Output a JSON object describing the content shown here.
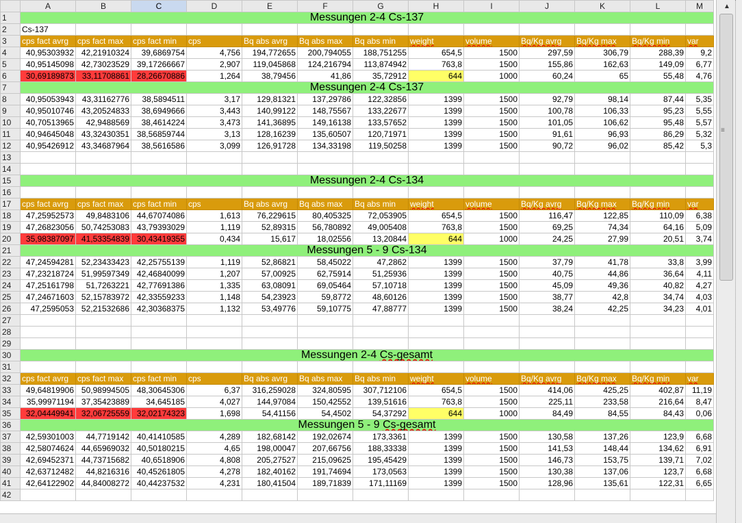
{
  "columns": [
    "A",
    "B",
    "C",
    "D",
    "E",
    "F",
    "G",
    "H",
    "I",
    "J",
    "K",
    "L",
    "M"
  ],
  "selected_column": "C",
  "rows": [
    {
      "n": "1",
      "type": "band",
      "text": "Messungen 2-4 Cs-137"
    },
    {
      "n": "2",
      "type": "text",
      "cells": [
        "Cs-137",
        "",
        "",
        "",
        "",
        "",
        "",
        "",
        "",
        "",
        "",
        "",
        ""
      ]
    },
    {
      "n": "3",
      "type": "hdr",
      "cells": [
        "cps fact avrg",
        "cps fact max",
        "cps fact min",
        "cps",
        "Bq abs avrg",
        "Bq abs max",
        "Bq abs min",
        "weight",
        "volume",
        "Bq/Kg avrg",
        "Bq/Kg max",
        "Bq/Kg min",
        "var"
      ]
    },
    {
      "n": "4",
      "type": "data",
      "cells": [
        "40,95303932",
        "42,21910324",
        "39,6869754",
        "4,756",
        "194,772655",
        "200,794055",
        "188,751255",
        "654,5",
        "1500",
        "297,59",
        "306,79",
        "288,39",
        "9,2"
      ]
    },
    {
      "n": "5",
      "type": "data",
      "cells": [
        "40,95145098",
        "42,73023529",
        "39,17266667",
        "2,907",
        "119,045868",
        "124,216794",
        "113,874942",
        "763,8",
        "1500",
        "155,86",
        "162,63",
        "149,09",
        "6,77"
      ]
    },
    {
      "n": "6",
      "type": "data",
      "red": true,
      "cells": [
        "30,69189873",
        "33,11708861",
        "28,26670886",
        "1,264",
        "38,79456",
        "41,86",
        "35,72912",
        "644",
        "1000",
        "60,24",
        "65",
        "55,48",
        "4,76"
      ]
    },
    {
      "n": "7",
      "type": "band",
      "text": "Messungen 2-4 Cs-137"
    },
    {
      "n": "8",
      "type": "data",
      "cells": [
        "40,95053943",
        "43,31162776",
        "38,5894511",
        "3,17",
        "129,81321",
        "137,29786",
        "122,32856",
        "1399",
        "1500",
        "92,79",
        "98,14",
        "87,44",
        "5,35"
      ]
    },
    {
      "n": "9",
      "type": "data",
      "cells": [
        "40,95010746",
        "43,20524833",
        "38,6949666",
        "3,443",
        "140,99122",
        "148,75567",
        "133,22677",
        "1399",
        "1500",
        "100,78",
        "106,33",
        "95,23",
        "5,55"
      ]
    },
    {
      "n": "10",
      "type": "data",
      "cells": [
        "40,70513965",
        "42,9488569",
        "38,4614224",
        "3,473",
        "141,36895",
        "149,16138",
        "133,57652",
        "1399",
        "1500",
        "101,05",
        "106,62",
        "95,48",
        "5,57"
      ]
    },
    {
      "n": "11",
      "type": "data",
      "cells": [
        "40,94645048",
        "43,32430351",
        "38,56859744",
        "3,13",
        "128,16239",
        "135,60507",
        "120,71971",
        "1399",
        "1500",
        "91,61",
        "96,93",
        "86,29",
        "5,32"
      ]
    },
    {
      "n": "12",
      "type": "data",
      "cells": [
        "40,95426912",
        "43,34687964",
        "38,5616586",
        "3,099",
        "126,91728",
        "134,33198",
        "119,50258",
        "1399",
        "1500",
        "90,72",
        "96,02",
        "85,42",
        "5,3"
      ]
    },
    {
      "n": "13",
      "type": "empty"
    },
    {
      "n": "14",
      "type": "empty"
    },
    {
      "n": "15",
      "type": "band",
      "text": "Messungen 2-4 Cs-134"
    },
    {
      "n": "16",
      "type": "empty"
    },
    {
      "n": "17",
      "type": "hdr",
      "cells": [
        "cps fact avrg",
        "cps fact max",
        "cps fact min",
        "cps",
        "Bq abs avrg",
        "Bq abs max",
        "Bq abs min",
        "weight",
        "volume",
        "Bq/Kg avrg",
        "Bq/Kg max",
        "Bq/Kg min",
        "var"
      ]
    },
    {
      "n": "18",
      "type": "data",
      "cells": [
        "47,25952573",
        "49,8483106",
        "44,67074086",
        "1,613",
        "76,229615",
        "80,405325",
        "72,053905",
        "654,5",
        "1500",
        "116,47",
        "122,85",
        "110,09",
        "6,38"
      ]
    },
    {
      "n": "19",
      "type": "data",
      "cells": [
        "47,26823056",
        "50,74253083",
        "43,79393029",
        "1,119",
        "52,89315",
        "56,780892",
        "49,005408",
        "763,8",
        "1500",
        "69,25",
        "74,34",
        "64,16",
        "5,09"
      ]
    },
    {
      "n": "20",
      "type": "data",
      "red": true,
      "cells": [
        "35,98387097",
        "41,53354839",
        "30,43419355",
        "0,434",
        "15,617",
        "18,02556",
        "13,20844",
        "644",
        "1000",
        "24,25",
        "27,99",
        "20,51",
        "3,74"
      ]
    },
    {
      "n": "21",
      "type": "band",
      "text": "Messungen 5 - 9 Cs-134"
    },
    {
      "n": "22",
      "type": "data",
      "cells": [
        "47,24594281",
        "52,23433423",
        "42,25755139",
        "1,119",
        "52,86821",
        "58,45022",
        "47,2862",
        "1399",
        "1500",
        "37,79",
        "41,78",
        "33,8",
        "3,99"
      ]
    },
    {
      "n": "23",
      "type": "data",
      "cells": [
        "47,23218724",
        "51,99597349",
        "42,46840099",
        "1,207",
        "57,00925",
        "62,75914",
        "51,25936",
        "1399",
        "1500",
        "40,75",
        "44,86",
        "36,64",
        "4,11"
      ]
    },
    {
      "n": "24",
      "type": "data",
      "cells": [
        "47,25161798",
        "51,7263221",
        "42,77691386",
        "1,335",
        "63,08091",
        "69,05464",
        "57,10718",
        "1399",
        "1500",
        "45,09",
        "49,36",
        "40,82",
        "4,27"
      ]
    },
    {
      "n": "25",
      "type": "data",
      "cells": [
        "47,24671603",
        "52,15783972",
        "42,33559233",
        "1,148",
        "54,23923",
        "59,8772",
        "48,60126",
        "1399",
        "1500",
        "38,77",
        "42,8",
        "34,74",
        "4,03"
      ]
    },
    {
      "n": "26",
      "type": "data",
      "cells": [
        "47,2595053",
        "52,21532686",
        "42,30368375",
        "1,132",
        "53,49776",
        "59,10775",
        "47,88777",
        "1399",
        "1500",
        "38,24",
        "42,25",
        "34,23",
        "4,01"
      ]
    },
    {
      "n": "27",
      "type": "empty"
    },
    {
      "n": "28",
      "type": "empty"
    },
    {
      "n": "29",
      "type": "empty"
    },
    {
      "n": "30",
      "type": "band",
      "text": "Messungen 2-4 Cs-gesamt"
    },
    {
      "n": "31",
      "type": "empty"
    },
    {
      "n": "32",
      "type": "hdr",
      "cells": [
        "cps fact avrg",
        "cps fact max",
        "cps fact min",
        "cps",
        "Bq abs avrg",
        "Bq abs max",
        "Bq abs min",
        "weight",
        "volume",
        "Bq/Kg avrg",
        "Bq/Kg max",
        "Bq/Kg min",
        "var"
      ]
    },
    {
      "n": "33",
      "type": "data",
      "cells": [
        "49,64819906",
        "50,98994505",
        "48,30645306",
        "6,37",
        "316,259028",
        "324,80595",
        "307,712106",
        "654,5",
        "1500",
        "414,06",
        "425,25",
        "402,87",
        "11,19"
      ]
    },
    {
      "n": "34",
      "type": "data",
      "cells": [
        "35,99971194",
        "37,35423889",
        "34,645185",
        "4,027",
        "144,97084",
        "150,42552",
        "139,51616",
        "763,8",
        "1500",
        "225,11",
        "233,58",
        "216,64",
        "8,47"
      ]
    },
    {
      "n": "35",
      "type": "data",
      "red": true,
      "cells": [
        "32,04449941",
        "32,06725559",
        "32,02174323",
        "1,698",
        "54,41156",
        "54,4502",
        "54,37292",
        "644",
        "1000",
        "84,49",
        "84,55",
        "84,43",
        "0,06"
      ]
    },
    {
      "n": "36",
      "type": "band",
      "text": "Messungen 5 - 9 Cs-gesamt"
    },
    {
      "n": "37",
      "type": "data",
      "cells": [
        "42,59301003",
        "44,7719142",
        "40,41410585",
        "4,289",
        "182,68142",
        "192,02674",
        "173,3361",
        "1399",
        "1500",
        "130,58",
        "137,26",
        "123,9",
        "6,68"
      ]
    },
    {
      "n": "38",
      "type": "data",
      "cells": [
        "42,58074624",
        "44,65969032",
        "40,50180215",
        "4,65",
        "198,00047",
        "207,66756",
        "188,33338",
        "1399",
        "1500",
        "141,53",
        "148,44",
        "134,62",
        "6,91"
      ]
    },
    {
      "n": "39",
      "type": "data",
      "cells": [
        "42,69452371",
        "44,73715682",
        "40,6518906",
        "4,808",
        "205,27527",
        "215,09625",
        "195,45429",
        "1399",
        "1500",
        "146,73",
        "153,75",
        "139,71",
        "7,02"
      ]
    },
    {
      "n": "40",
      "type": "data",
      "cells": [
        "42,63712482",
        "44,8216316",
        "40,45261805",
        "4,278",
        "182,40162",
        "191,74694",
        "173,0563",
        "1399",
        "1500",
        "130,38",
        "137,06",
        "123,7",
        "6,68"
      ]
    },
    {
      "n": "41",
      "type": "data",
      "cells": [
        "42,64122902",
        "44,84008272",
        "40,44237532",
        "4,231",
        "180,41504",
        "189,71839",
        "171,11169",
        "1399",
        "1500",
        "128,96",
        "135,61",
        "122,31",
        "6,65"
      ]
    },
    {
      "n": "42",
      "type": "empty"
    }
  ],
  "colors": {
    "header": "#d99b0c",
    "band": "#8ff07b",
    "red": "#ff3b3b",
    "yellow": "#ffff66"
  },
  "scrollbar": {
    "up_icon": "triangle-up-icon",
    "grip_icon": "grip-icon"
  }
}
